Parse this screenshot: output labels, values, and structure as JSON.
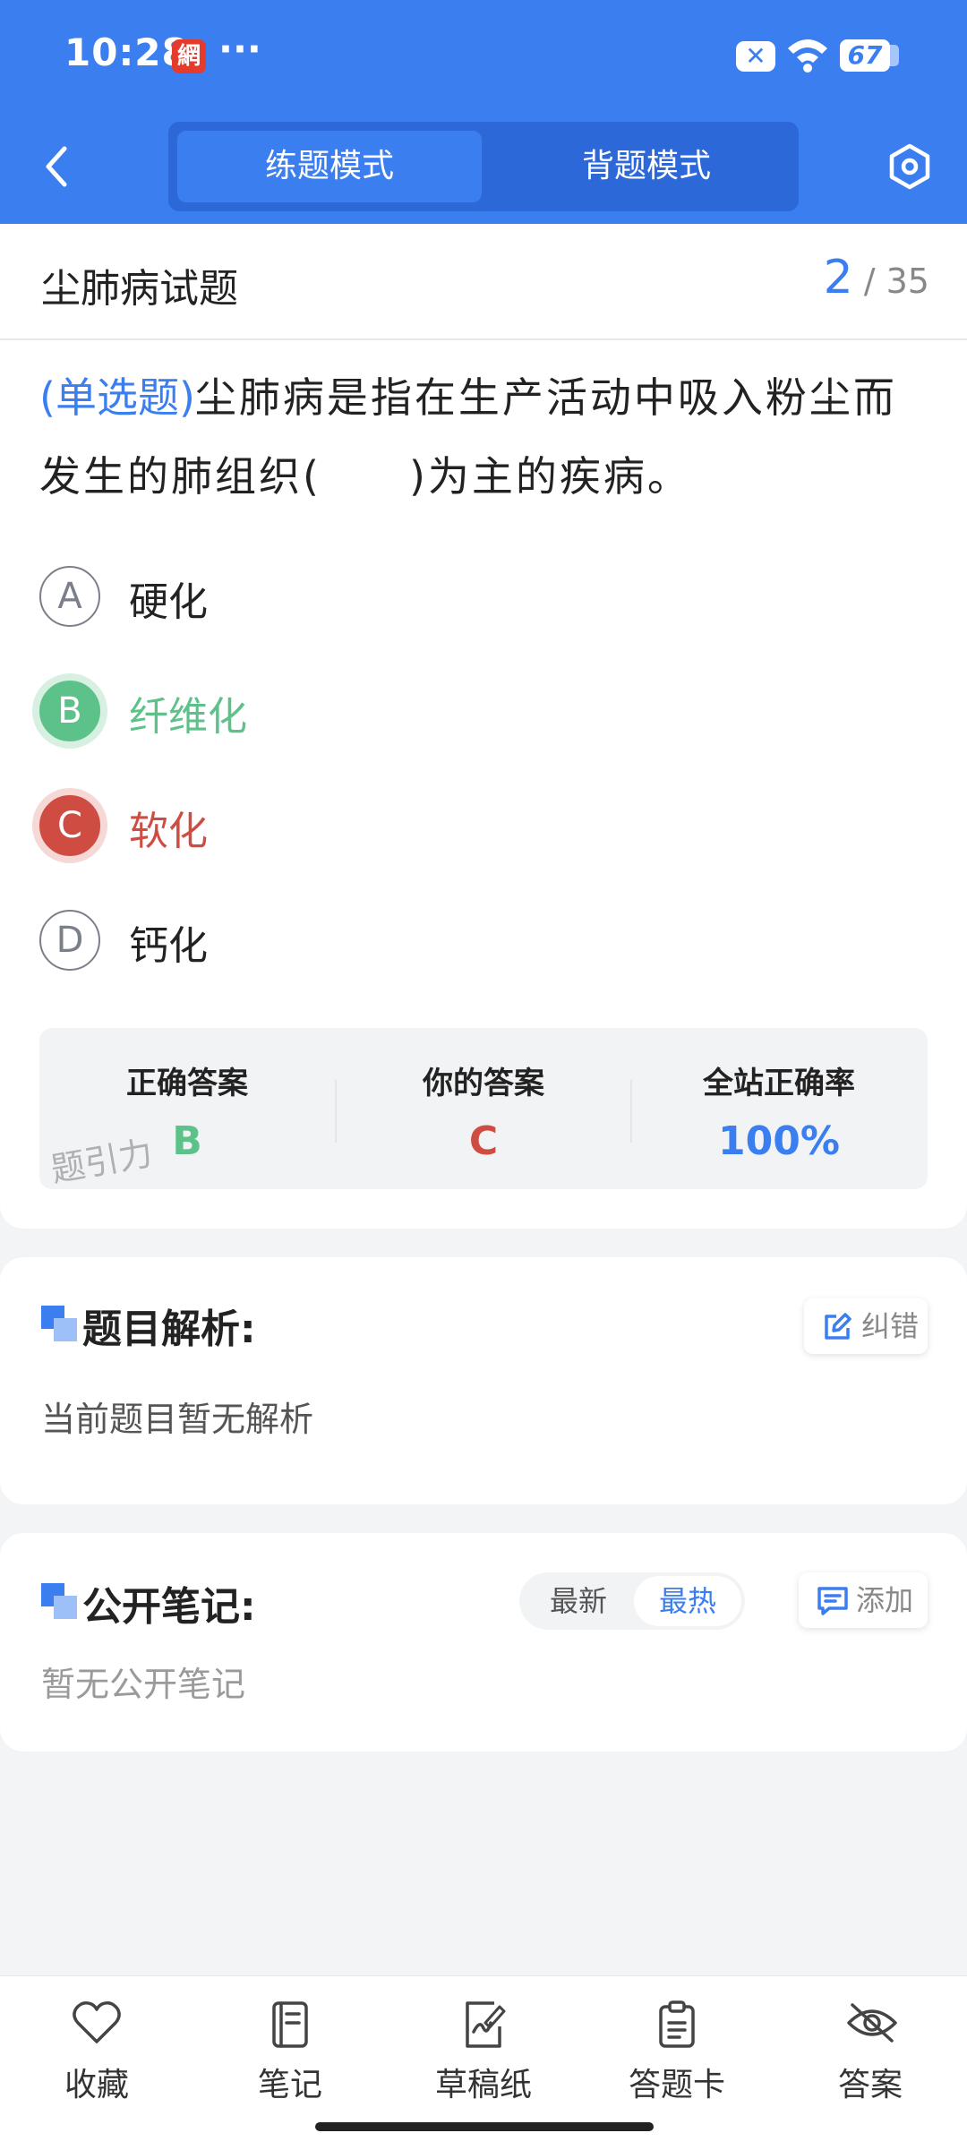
{
  "status_bar": {
    "time": "10:28",
    "app_icon": "網",
    "more": "···",
    "sim": "✕",
    "battery": "67"
  },
  "header": {
    "tabs": [
      {
        "label": "练题模式",
        "active": true
      },
      {
        "label": "背题模式",
        "active": false
      }
    ]
  },
  "question": {
    "section_title": "尘肺病试题",
    "current": "2",
    "total": "/ 35",
    "type": "(单选题)",
    "text": "尘肺病是指在生产活动中吸入粉尘而发生的肺组织(　　)为主的疾病。",
    "options": [
      {
        "letter": "A",
        "text": "硬化",
        "state": "normal"
      },
      {
        "letter": "B",
        "text": "纤维化",
        "state": "correct"
      },
      {
        "letter": "C",
        "text": "软化",
        "state": "wrong"
      },
      {
        "letter": "D",
        "text": "钙化",
        "state": "normal"
      }
    ]
  },
  "stats": {
    "correct_label": "正确答案",
    "correct_value": "B",
    "yours_label": "你的答案",
    "yours_value": "C",
    "rate_label": "全站正确率",
    "rate_value": "100%",
    "watermark": "题引力"
  },
  "analysis": {
    "title": "题目解析:",
    "report_label": "纠错",
    "body": "当前题目暂无解析"
  },
  "notes": {
    "title": "公开笔记:",
    "sort_latest": "最新",
    "sort_hot": "最热",
    "add_label": "添加",
    "body": "暂无公开笔记"
  },
  "bottom_bar": [
    {
      "label": "收藏",
      "icon": "heart-icon"
    },
    {
      "label": "笔记",
      "icon": "notebook-icon"
    },
    {
      "label": "草稿纸",
      "icon": "draft-icon"
    },
    {
      "label": "答题卡",
      "icon": "clipboard-icon"
    },
    {
      "label": "答案",
      "icon": "eye-off-icon"
    }
  ],
  "colors": {
    "primary": "#3b7ef0",
    "correct": "#5cc28a",
    "wrong": "#cf4c43"
  }
}
